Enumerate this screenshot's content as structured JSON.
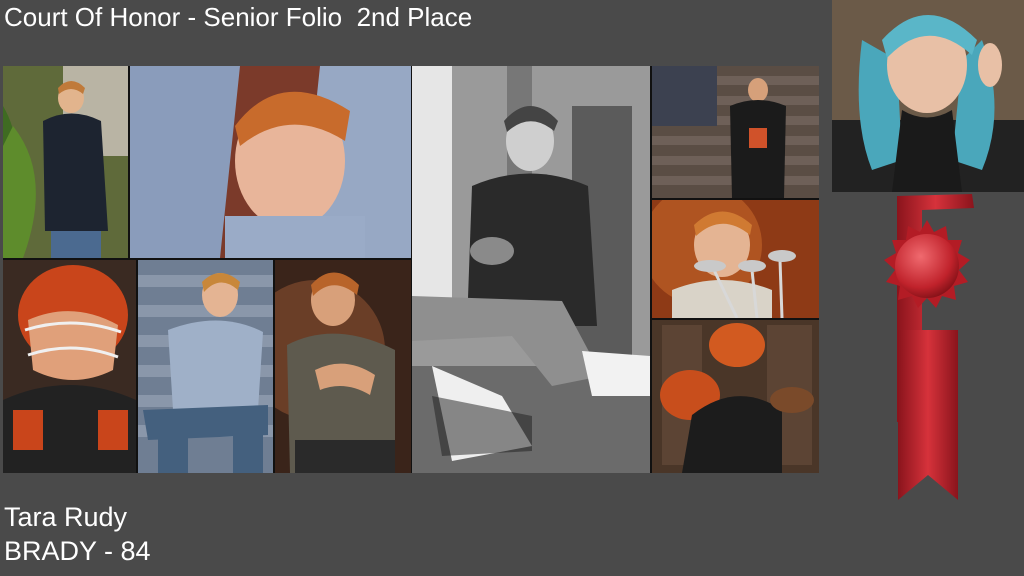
{
  "header": {
    "title": "Court Of Honor - Senior Folio  2nd Place"
  },
  "entry": {
    "photographer": "Tara Rudy",
    "subject_score": "BRADY - 84"
  },
  "colors": {
    "background": "#4a4a4a",
    "text": "#ffffff",
    "ribbon": "#c0222b"
  }
}
